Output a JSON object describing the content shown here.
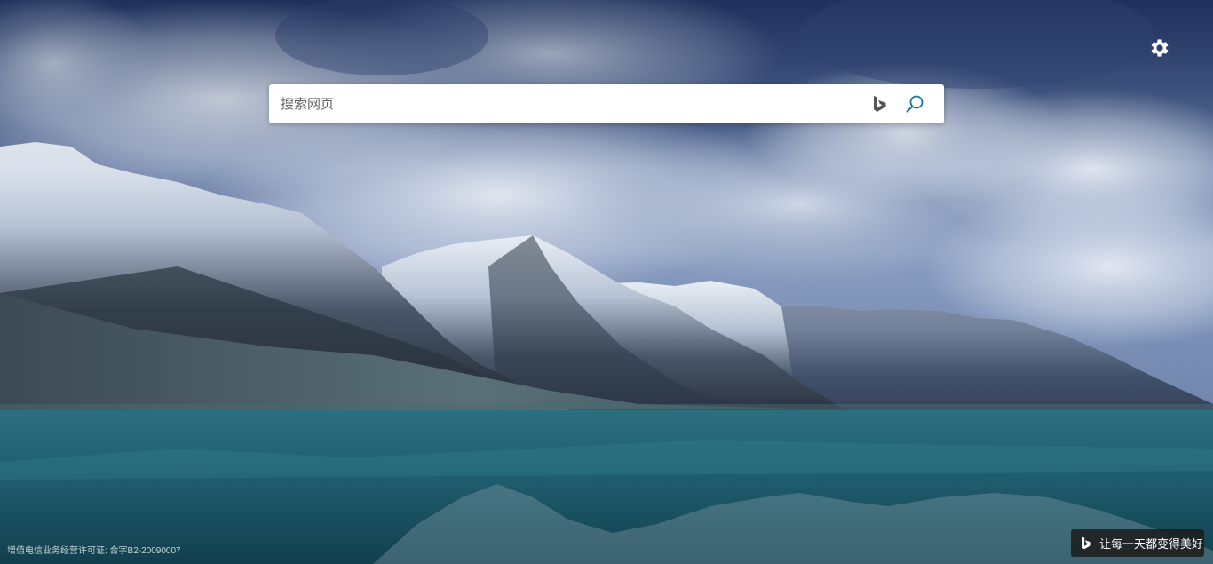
{
  "search": {
    "placeholder": "搜索网页",
    "value": ""
  },
  "icons": {
    "settings": "gear-icon",
    "bing": "bing-logo-icon",
    "search": "search-icon",
    "slogan": "bing-logo-icon"
  },
  "footer": {
    "license": "增值电信业务经营许可证: 合字B2-20090007",
    "slogan": "让每一天都变得美好"
  },
  "colors": {
    "search_icon": "#1a6fb0",
    "bing_icon": "#555555",
    "slogan_bg": "#1e1e1e"
  }
}
